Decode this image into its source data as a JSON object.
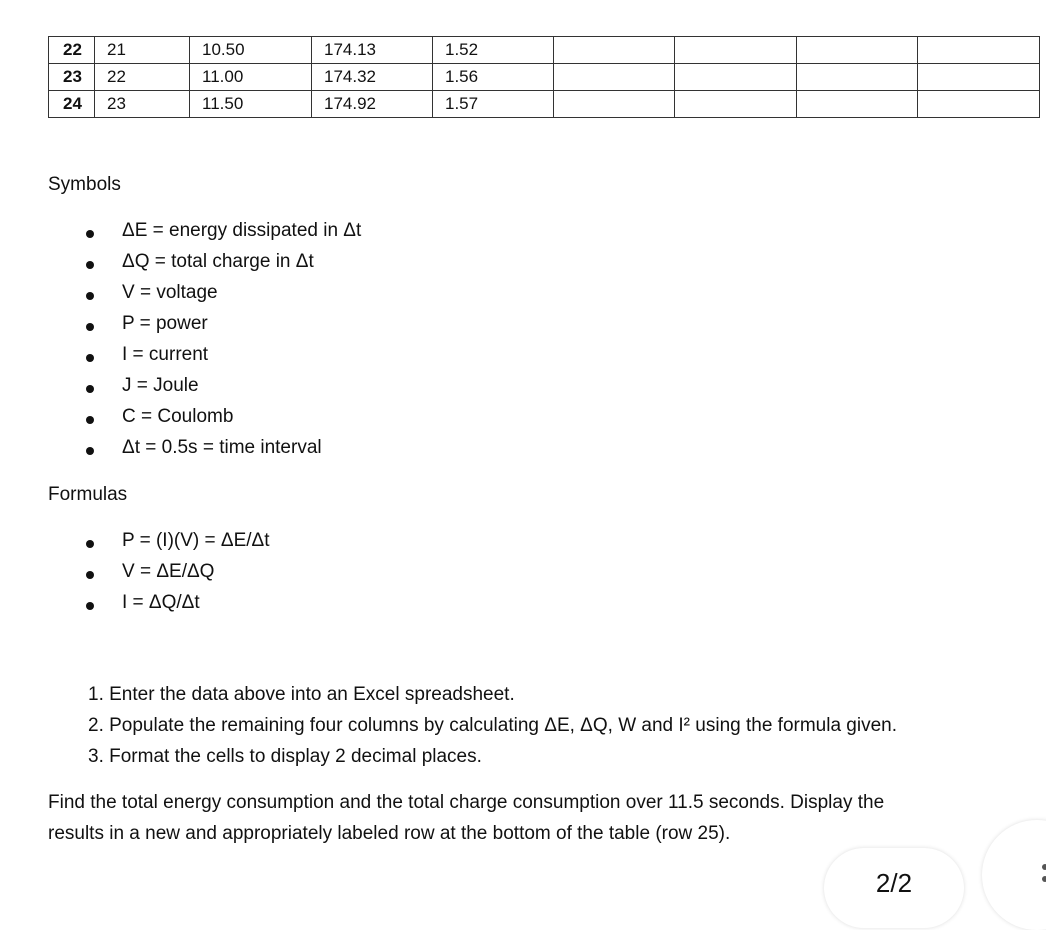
{
  "table": {
    "rows": [
      [
        "22",
        "21",
        "10.50",
        "174.13",
        "1.52",
        "",
        "",
        "",
        ""
      ],
      [
        "23",
        "22",
        "11.00",
        "174.32",
        "1.56",
        "",
        "",
        "",
        ""
      ],
      [
        "24",
        "23",
        "11.50",
        "174.92",
        "1.57",
        "",
        "",
        "",
        ""
      ]
    ]
  },
  "symbols": {
    "heading": "Symbols",
    "items": [
      "ΔE = energy dissipated in Δt",
      "ΔQ = total charge in Δt",
      "V = voltage",
      "P = power",
      "I = current",
      "J = Joule",
      "C = Coulomb",
      "Δt = 0.5s = time interval"
    ]
  },
  "formulas": {
    "heading": "Formulas",
    "items": [
      "P = (I)(V) = ΔE/Δt",
      "V = ΔE/ΔQ",
      "I = ΔQ/Δt"
    ]
  },
  "steps": [
    "1.  Enter the data above into an Excel spreadsheet.",
    "2.  Populate the remaining four columns by calculating ΔE, ΔQ, W and I² using the formula given.",
    "3.  Format the cells to display 2 decimal places."
  ],
  "paragraph": [
    "Find the total energy consumption and the total charge consumption over 11.5 seconds. Display the",
    "results in a new and appropriately labeled row at the bottom of the table (row 25)."
  ],
  "page_indicator": "2/2"
}
